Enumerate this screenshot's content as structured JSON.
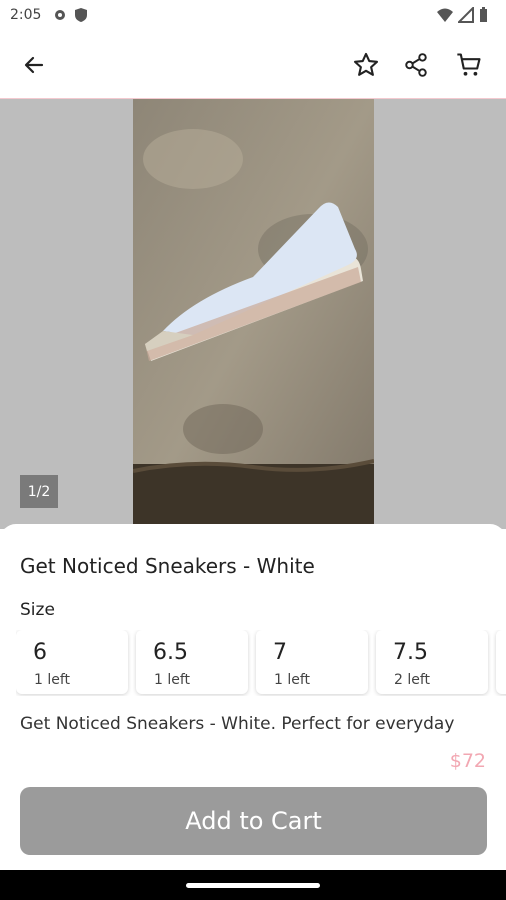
{
  "status": {
    "time": "2:05"
  },
  "gallery": {
    "counter": "1/2"
  },
  "product": {
    "title": "Get Noticed Sneakers - White",
    "size_label": "Size",
    "sizes": [
      {
        "size": "6",
        "stock": "1 left"
      },
      {
        "size": "6.5",
        "stock": "1 left"
      },
      {
        "size": "7",
        "stock": "1 left"
      },
      {
        "size": "7.5",
        "stock": "2 left"
      }
    ],
    "description": "Get Noticed Sneakers - White. Perfect for everyday",
    "price": "$72"
  },
  "actions": {
    "add_to_cart": "Add to Cart"
  },
  "icons": {
    "back": "arrow-left-icon",
    "favorite": "star-icon",
    "share": "share-icon",
    "cart": "cart-icon"
  },
  "colors": {
    "accent": "#f2a7b2",
    "button": "#9b9b9b",
    "gallery_bg": "#bdbdbd"
  }
}
